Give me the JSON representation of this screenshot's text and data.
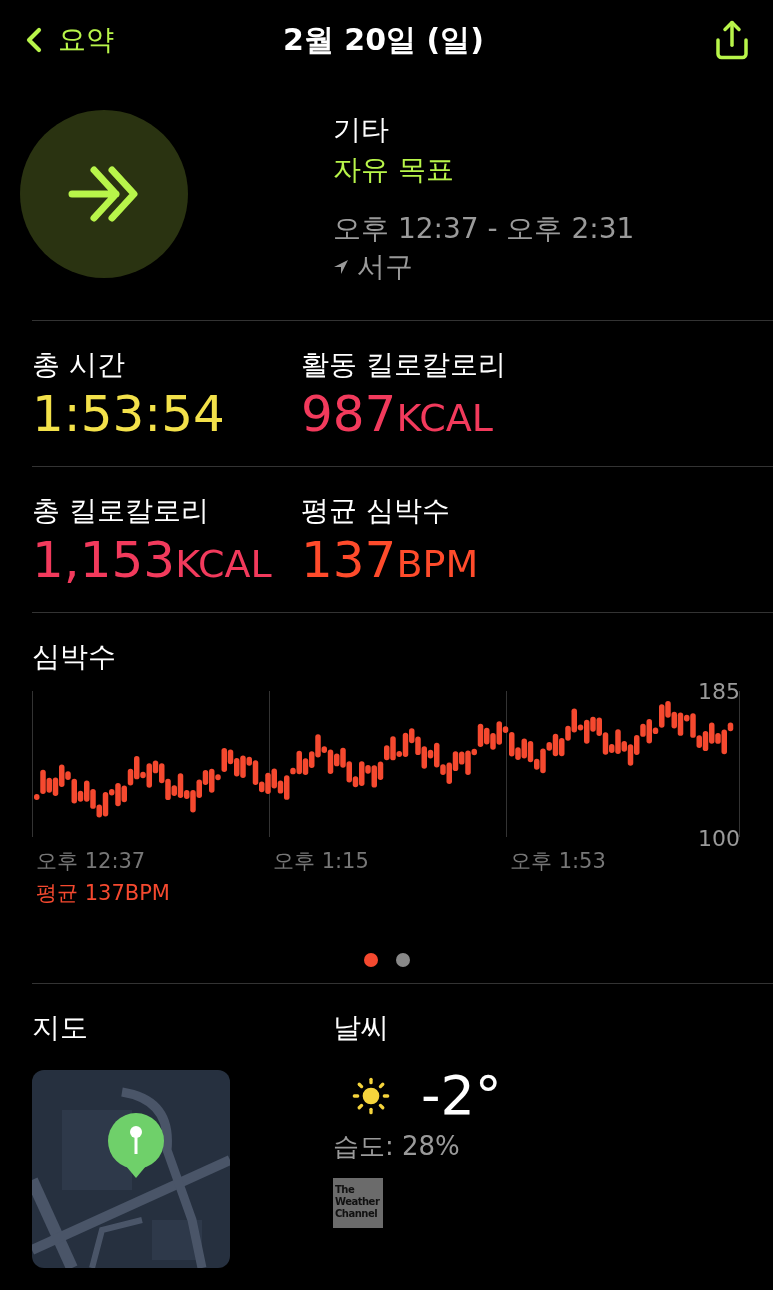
{
  "nav": {
    "back_label": "요약",
    "title": "2월 20일 (일)"
  },
  "workout": {
    "type": "기타",
    "goal": "자유 목표",
    "time_range": "오후 12:37 - 오후 2:31",
    "location": "서구"
  },
  "stats": [
    {
      "label": "총 시간",
      "value": "1:53:54",
      "color": "#f3e14a"
    },
    {
      "label": "활동 킬로칼로리",
      "value": "987",
      "unit": "KCAL",
      "color": "#f23a5c"
    },
    {
      "label": "총 킬로칼로리",
      "value": "1,153",
      "unit": "KCAL",
      "color": "#f23a5c"
    },
    {
      "label": "평균 심박수",
      "value": "137",
      "unit": "BPM",
      "color": "#ff4b2b"
    }
  ],
  "heart_rate": {
    "title": "심박수",
    "y_max_label": "185",
    "y_min_label": "100",
    "time_labels": [
      "오후 12:37",
      "오후 1:15",
      "오후 1:53"
    ],
    "average": "평균 137BPM"
  },
  "pager": [
    {
      "selected": true
    },
    {
      "selected": false
    }
  ],
  "map": {
    "title": "지도"
  },
  "weather": {
    "title": "날씨",
    "temperature": "-2°",
    "humidity": "습도: 28%",
    "provider_logo": "The\nWeather\nChannel"
  }
}
